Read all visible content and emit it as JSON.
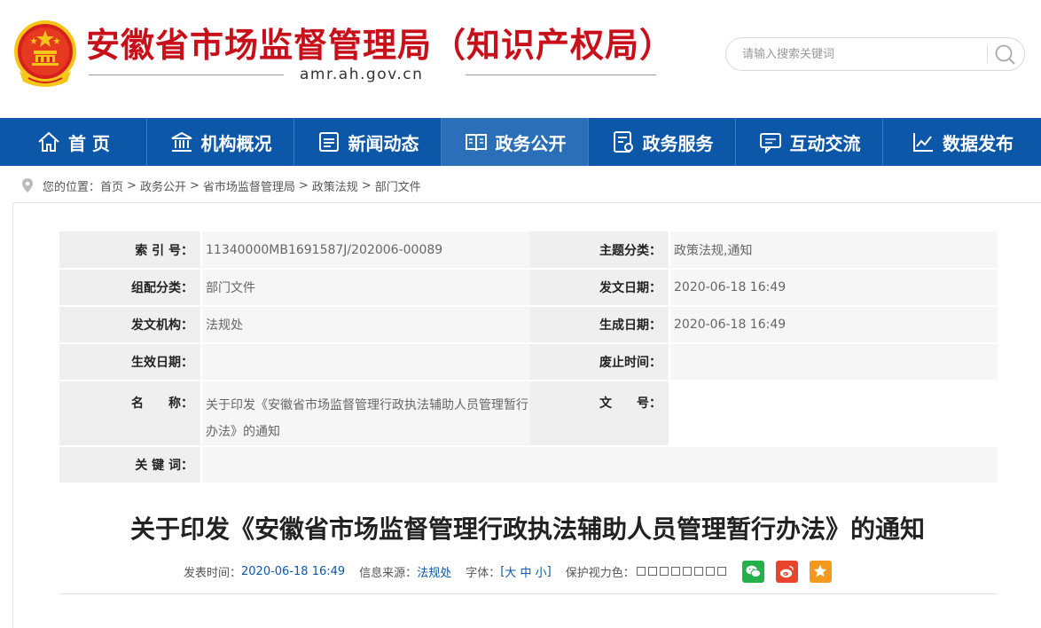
{
  "header": {
    "site_title": "安徽省市场监督管理局（知识产权局）",
    "domain": "amr.ah.gov.cn",
    "search_placeholder": "请输入搜索关键词"
  },
  "nav": {
    "items": [
      {
        "label": "首 页",
        "icon": "home-icon"
      },
      {
        "label": "机构概况",
        "icon": "institution-icon"
      },
      {
        "label": "新闻动态",
        "icon": "newspaper-icon"
      },
      {
        "label": "政务公开",
        "icon": "open-book-icon",
        "active": true
      },
      {
        "label": "政务服务",
        "icon": "service-document-icon"
      },
      {
        "label": "互动交流",
        "icon": "chat-icon"
      },
      {
        "label": "数据发布",
        "icon": "line-chart-icon"
      }
    ]
  },
  "breadcrumb": {
    "prefix": "您的位置：",
    "items": [
      "首页",
      "政务公开",
      "省市场监督管理局",
      "政策法规",
      "部门文件"
    ],
    "separator": ">"
  },
  "meta": {
    "index_label": "索 引 号：",
    "index_value": "11340000MB1691587J/202006-00089",
    "topic_label": "主题分类：",
    "topic_value": "政策法规,通知",
    "group_label": "组配分类：",
    "group_value": "部门文件",
    "issue_date_label": "发文日期：",
    "issue_date_value": "2020-06-18 16:49",
    "issuer_label": "发文机构：",
    "issuer_value": "法规处",
    "gen_date_label": "生成日期：",
    "gen_date_value": "2020-06-18 16:49",
    "effective_label": "生效日期：",
    "effective_value": "",
    "abolish_label": "废止时间：",
    "abolish_value": "",
    "name_label": "名　　称：",
    "name_value": "关于印发《安徽省市场监督管理行政执法辅助人员管理暂行办法》的通知",
    "docno_label": "文　　号：",
    "docno_value": "",
    "keywords_label": "关 键 词：",
    "keywords_value": ""
  },
  "article": {
    "title": "关于印发《安徽省市场监督管理行政执法辅助人员管理暂行办法》的通知",
    "publish_label": "发表时间：",
    "publish_value": "2020-06-18 16:49",
    "source_label": "信息来源：",
    "source_value": "法规处",
    "font_label": "字体：",
    "font_open": "[ ",
    "font_large": "大",
    "font_medium": "中",
    "font_small": "小",
    "font_close": " ]",
    "eye_label": "保护视力色：",
    "eye_colors": [
      "#ffffff",
      "#ffffff",
      "#ffffff",
      "#ffffff",
      "#ffffff",
      "#ffffff",
      "#ffffff",
      "#ffffff"
    ]
  },
  "colors": {
    "brand_red": "#c8101b",
    "nav_blue": "#0d57a8",
    "nav_active": "#2a6fb8",
    "wechat": "#22b14c",
    "weibo": "#e6442b",
    "favorite": "#f39a1e"
  }
}
